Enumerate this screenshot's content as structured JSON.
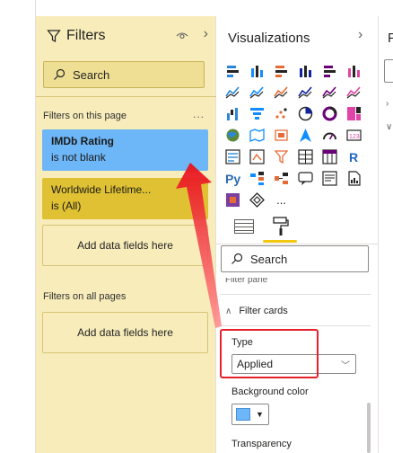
{
  "filters": {
    "title": "Filters",
    "search_placeholder": "Search",
    "on_this_page_label": "Filters on this page",
    "more_label": "...",
    "cards": [
      {
        "title": "IMDb Rating",
        "subtitle": "is not blank"
      },
      {
        "title": "Worldwide Lifetime...",
        "subtitle": "is (All)"
      }
    ],
    "add_fields_label": "Add data fields here",
    "on_all_pages_label": "Filters on all pages",
    "card_color_highlight": "#6db6f7",
    "card_color_default": "#dfc133"
  },
  "visualizations": {
    "title": "Visualizations",
    "icons": [
      "stacked-bar-icon",
      "stacked-column-icon",
      "clustered-bar-icon",
      "clustered-column-icon",
      "100-stacked-bar-icon",
      "100-stacked-column-icon",
      "line-chart-icon",
      "area-chart-icon",
      "stacked-area-icon",
      "line-clustered-column-icon",
      "line-stacked-column-icon",
      "ribbon-chart-icon",
      "waterfall-icon",
      "funnel-icon",
      "scatter-icon",
      "pie-chart-icon",
      "donut-chart-icon",
      "treemap-icon",
      "map-icon",
      "filled-map-icon",
      "shape-map-icon",
      "azure-map-icon",
      "gauge-icon",
      "card-icon",
      "multi-row-card-icon",
      "kpi-icon",
      "slicer-icon",
      "table-icon",
      "matrix-icon",
      "r-visual-icon",
      "python-visual-icon",
      "key-influencers-icon",
      "decomposition-tree-icon",
      "qa-icon",
      "narrative-icon",
      "paginated-report-icon",
      "power-apps-icon",
      "power-automate-icon",
      "more-visuals-icon"
    ],
    "more_glyph": "...",
    "search_placeholder": "Search",
    "partial_section_label": "Filter pane",
    "filter_cards_label": "Filter cards",
    "type_label": "Type",
    "type_value": "Applied",
    "background_color_label": "Background color",
    "background_color_value": "#6db6f7",
    "transparency_label": "Transparency"
  }
}
